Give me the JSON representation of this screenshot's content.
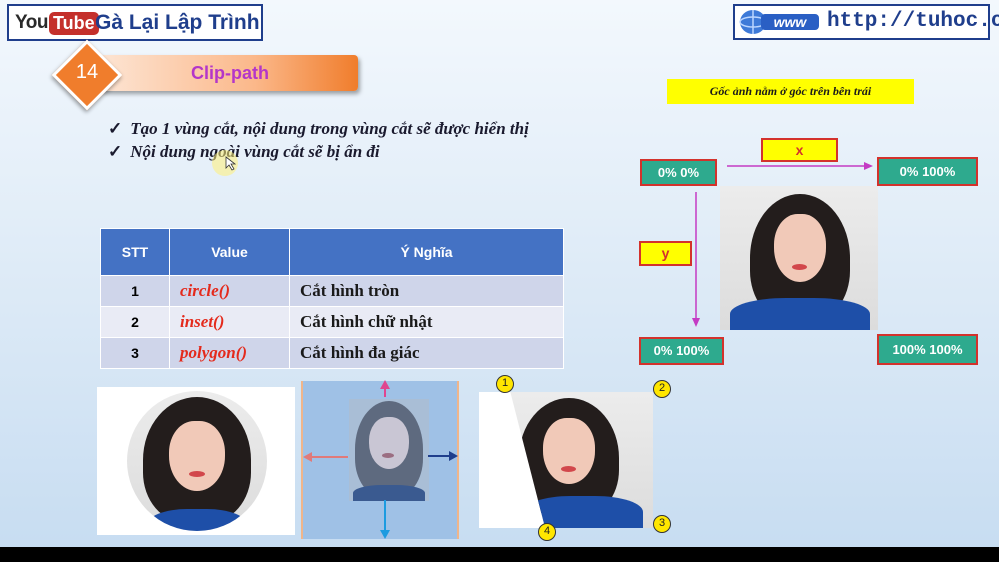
{
  "header": {
    "youtube_you": "You",
    "youtube_tube": "Tube",
    "channel_name": "Gà Lại Lập Trình",
    "site_url": "http://tuhoc.cc"
  },
  "lesson": {
    "number": "14",
    "title": "Clip-path"
  },
  "bullets": [
    "Tạo 1 vùng cắt, nội dung trong vùng cắt sẽ được hiển thị",
    "Nội dung ngoài vùng cắt sẽ bị ẩn đi"
  ],
  "table": {
    "headers": [
      "STT",
      "Value",
      "Ý Nghĩa"
    ],
    "rows": [
      {
        "stt": "1",
        "value": "circle()",
        "meaning": "Cắt hình tròn"
      },
      {
        "stt": "2",
        "value": "inset()",
        "meaning": "Cắt hình chữ nhật"
      },
      {
        "stt": "3",
        "value": "polygon()",
        "meaning": "Cắt hình đa giác"
      }
    ]
  },
  "diagram": {
    "note": "Gốc ảnh nằm ở góc trên bên trái",
    "x_label": "x",
    "y_label": "y",
    "top_left": "0% 0%",
    "top_right": "0% 100%",
    "bottom_left": "0% 100%",
    "bottom_right": "100% 100%"
  },
  "polygon_points": [
    "1",
    "2",
    "3",
    "4"
  ],
  "colors": {
    "brand_blue": "#1f3e8c",
    "table_header": "#4472c4",
    "value_red": "#e42a1c",
    "label_green": "#2eaa8e",
    "highlight_yellow": "#ffff00",
    "banner_orange": "#f07d2c",
    "title_purple": "#b436c9"
  }
}
